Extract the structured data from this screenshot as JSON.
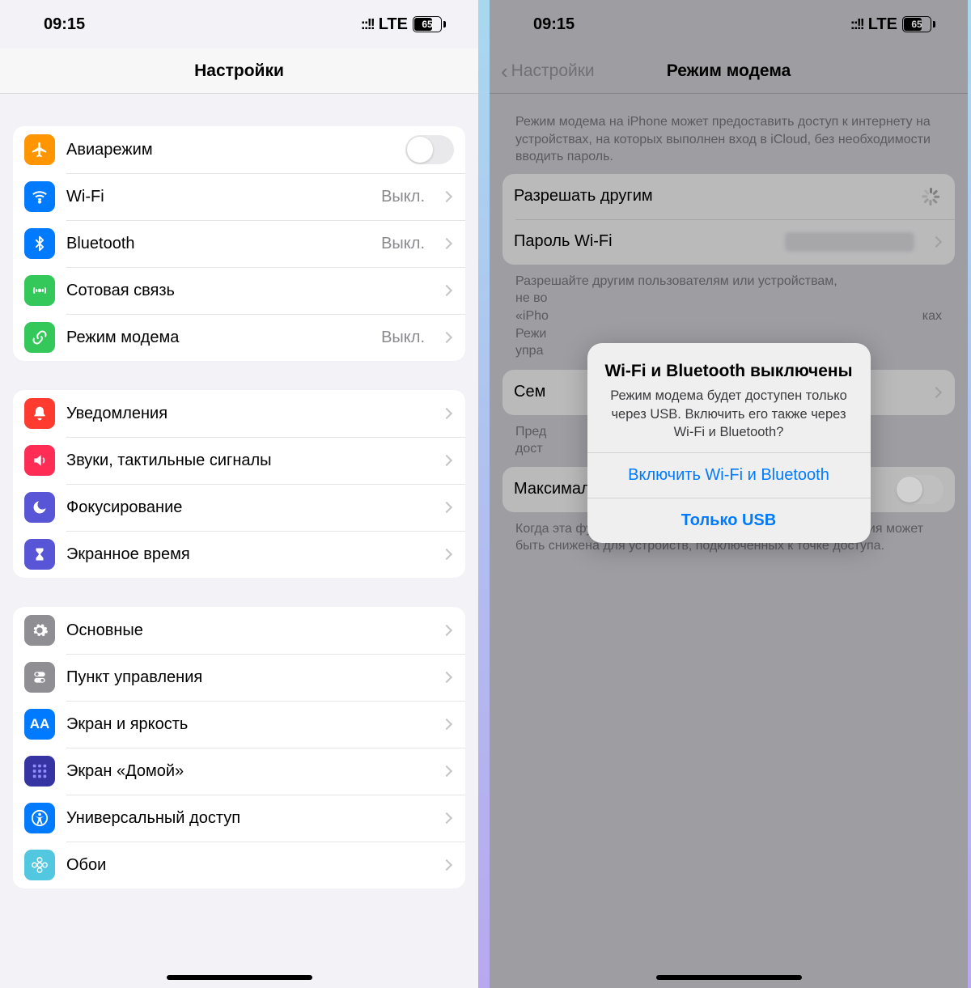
{
  "status": {
    "time": "09:15",
    "lte": "LTE",
    "battery": "65"
  },
  "left": {
    "title": "Настройки",
    "groups": [
      [
        {
          "icon": "airplane",
          "color": "#ff9500",
          "label": "Авиарежим",
          "kind": "toggle"
        },
        {
          "icon": "wifi",
          "color": "#007aff",
          "label": "Wi-Fi",
          "value": "Выкл."
        },
        {
          "icon": "bluetooth",
          "color": "#007aff",
          "label": "Bluetooth",
          "value": "Выкл."
        },
        {
          "icon": "antenna",
          "color": "#34c759",
          "label": "Сотовая связь"
        },
        {
          "icon": "link",
          "color": "#34c759",
          "label": "Режим модема",
          "value": "Выкл."
        }
      ],
      [
        {
          "icon": "bell",
          "color": "#ff3b30",
          "label": "Уведомления"
        },
        {
          "icon": "speaker",
          "color": "#ff2d55",
          "label": "Звуки, тактильные сигналы"
        },
        {
          "icon": "moon",
          "color": "#5856d6",
          "label": "Фокусирование"
        },
        {
          "icon": "hourglass",
          "color": "#5856d6",
          "label": "Экранное время"
        }
      ],
      [
        {
          "icon": "gear",
          "color": "#8e8e93",
          "label": "Основные"
        },
        {
          "icon": "sliders",
          "color": "#8e8e93",
          "label": "Пункт управления"
        },
        {
          "icon": "aa",
          "color": "#007aff",
          "label": "Экран и яркость"
        },
        {
          "icon": "grid",
          "color": "#3a3aee",
          "label": "Экран «Домой»"
        },
        {
          "icon": "access",
          "color": "#007aff",
          "label": "Универсальный доступ"
        },
        {
          "icon": "flower",
          "color": "#52c7e0",
          "label": "Обои"
        }
      ]
    ]
  },
  "right": {
    "back": "Настройки",
    "title": "Режим модема",
    "intro": "Режим модема на iPhone может предоставить доступ к интернету на устройствах, на которых выполнен вход в iCloud, без необходимости вводить пароль.",
    "rows": {
      "allow": "Разрешать другим",
      "pwd": "Пароль Wi-Fi"
    },
    "note2a": "Разрешайте другим пользователям или устройствам,",
    "note2b": "не во",
    "note2c": "«iPho",
    "note2d": "Режи",
    "note2e": "упра",
    "note2t": "ках",
    "family": "Сем",
    "note3a": "Пред",
    "note3b": "дост",
    "compat": "Максимальная совместимость",
    "note4": "Когда эта функция включена, скорость интернет-соединения может быть снижена для устройств, подключенных к точке доступа.",
    "modal": {
      "title": "Wi-Fi и Bluetooth выключены",
      "body": "Режим модема будет доступен только через USB. Включить его также через Wi-Fi и Bluetooth?",
      "btn1": "Включить Wi-Fi и Bluetooth",
      "btn2": "Только USB"
    }
  }
}
